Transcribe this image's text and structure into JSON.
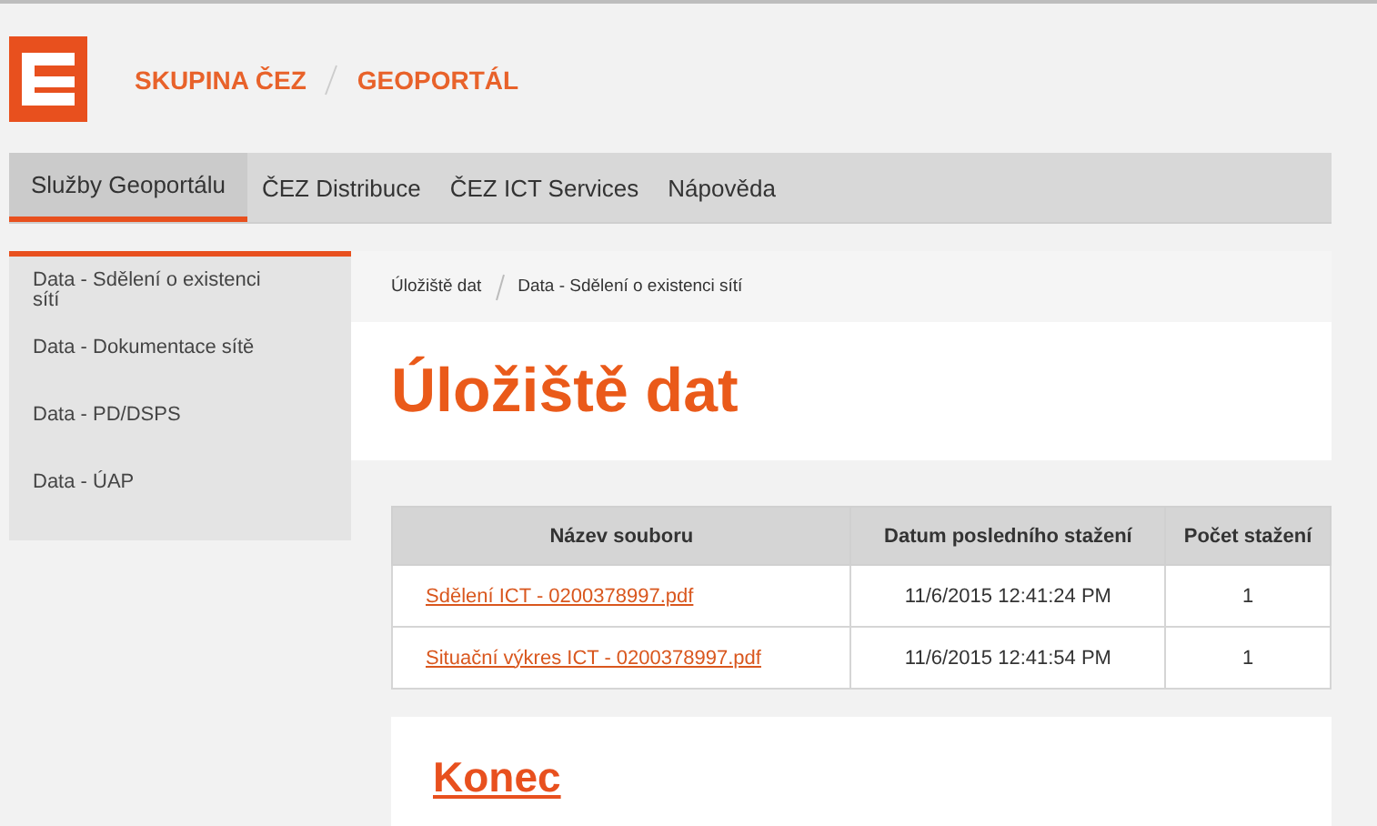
{
  "header": {
    "brand": "SKUPINA ČEZ",
    "portal": "GEOPORTÁL"
  },
  "nav": [
    {
      "label": "Služby Geoportálu",
      "selected": true
    },
    {
      "label": "ČEZ Distribuce",
      "selected": false
    },
    {
      "label": "ČEZ ICT Services",
      "selected": false
    },
    {
      "label": "Nápověda",
      "selected": false
    }
  ],
  "sidebar": {
    "items": [
      {
        "label": "Data - Sdělení o existenci sítí"
      },
      {
        "label": "Data - Dokumentace sítě"
      },
      {
        "label": "Data - PD/DSPS"
      },
      {
        "label": "Data - ÚAP"
      }
    ]
  },
  "breadcrumb": [
    "Úložiště dat",
    "Data - Sdělení o existenci sítí"
  ],
  "title": "Úložiště dat",
  "table": {
    "columns": [
      "Název souboru",
      "Datum posledního stažení",
      "Počet stažení"
    ],
    "rows": [
      {
        "file": "Sdělení ICT - 0200378997.pdf",
        "date": "11/6/2015 12:41:24 PM",
        "count": "1"
      },
      {
        "file": "Situační výkres ICT - 0200378997.pdf",
        "date": "11/6/2015 12:41:54 PM",
        "count": "1"
      }
    ]
  },
  "footer_heading": "Konec"
}
